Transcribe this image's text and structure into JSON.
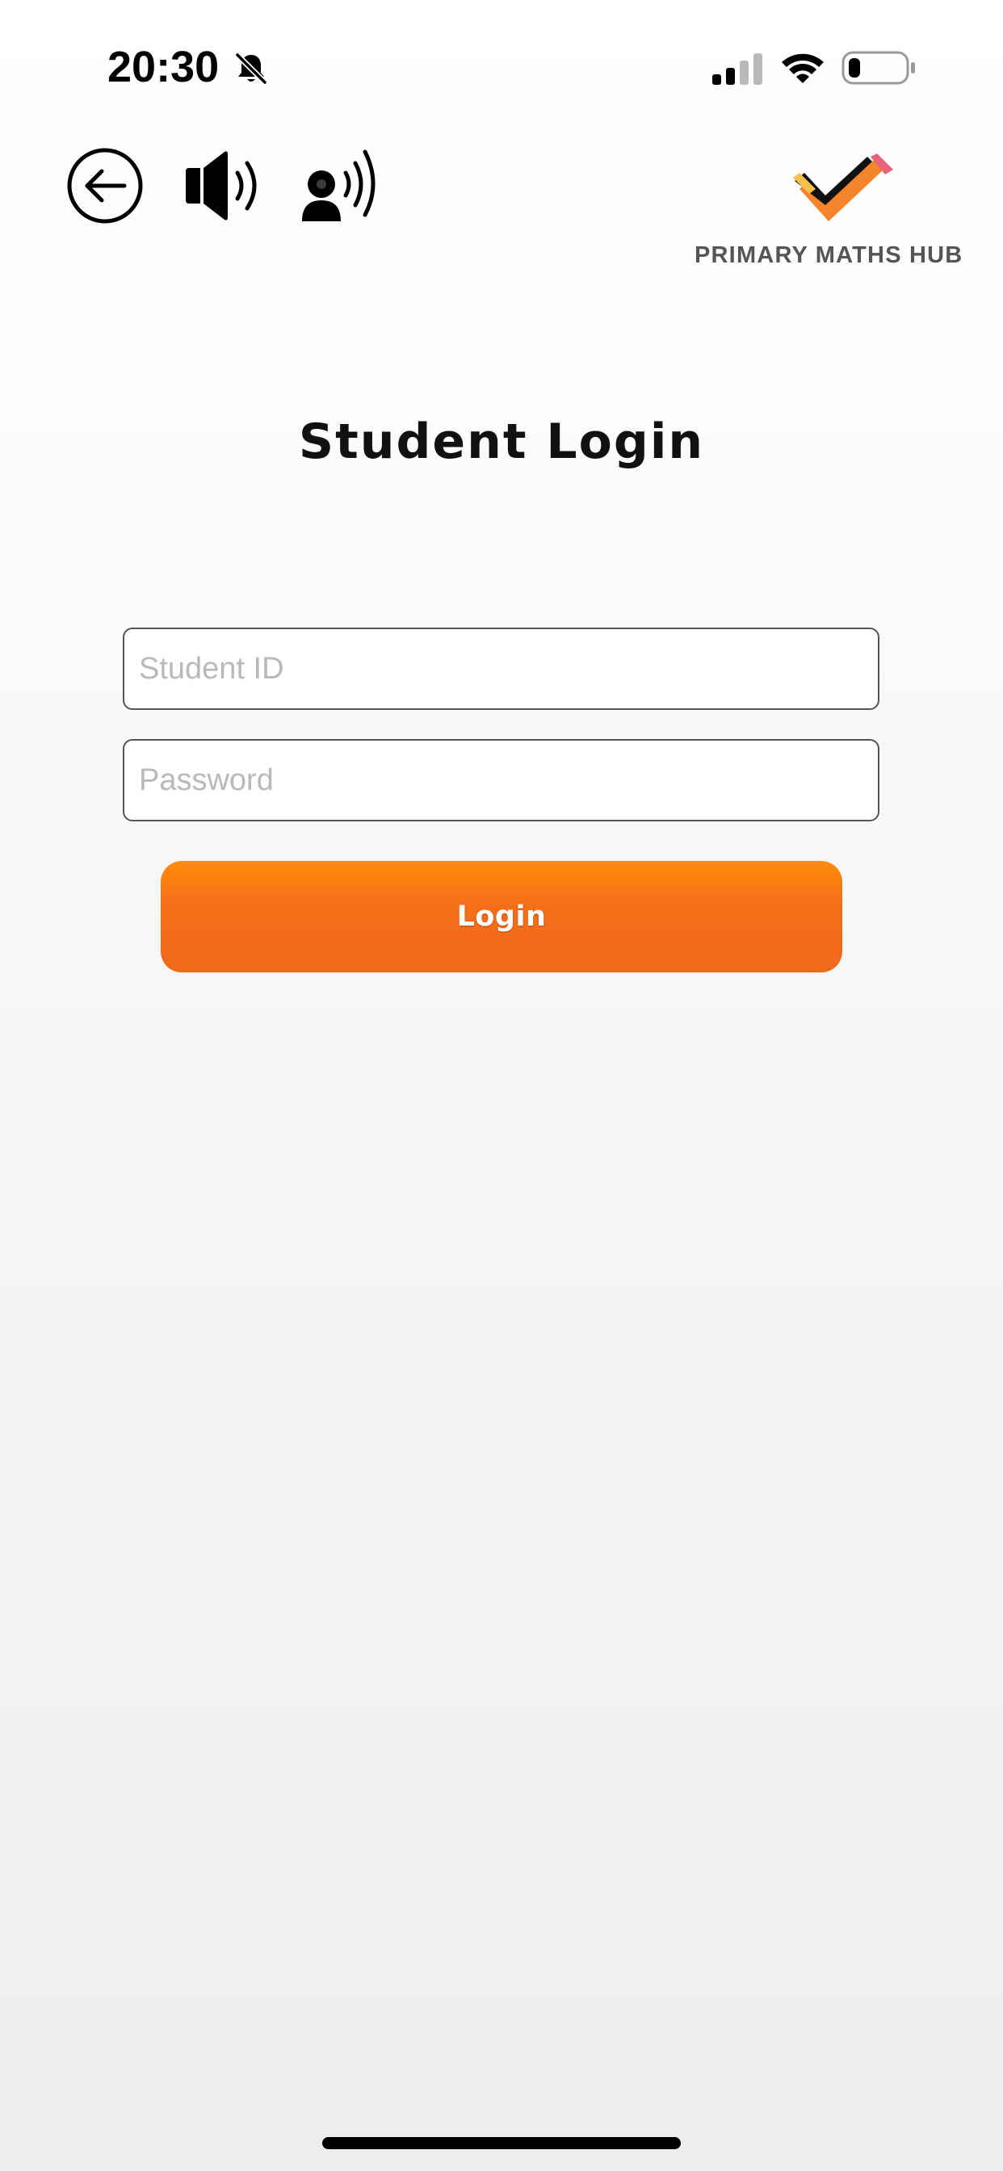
{
  "status_bar": {
    "time": "20:30",
    "icons": [
      "bell-slash-icon",
      "cellular-signal-icon",
      "wifi-icon",
      "battery-icon"
    ]
  },
  "toolbar": {
    "icons": [
      "back-arrow-icon",
      "speaker-icon",
      "voice-assist-icon"
    ]
  },
  "logo": {
    "text": "PRIMARY MATHS HUB",
    "colors": {
      "check_black": "#111111",
      "check_orange": "#f5842b",
      "check_yellow": "#f7c04a",
      "check_pink": "#e9637a"
    }
  },
  "page": {
    "title": "Student Login"
  },
  "form": {
    "student_id": {
      "value": "",
      "placeholder": "Student ID"
    },
    "password": {
      "value": "",
      "placeholder": "Password"
    },
    "login_label": "Login"
  },
  "colors": {
    "accent_top": "#ff8d0a",
    "accent_bottom": "#f2691c",
    "field_border": "#555555",
    "placeholder": "#b9b9b9"
  }
}
